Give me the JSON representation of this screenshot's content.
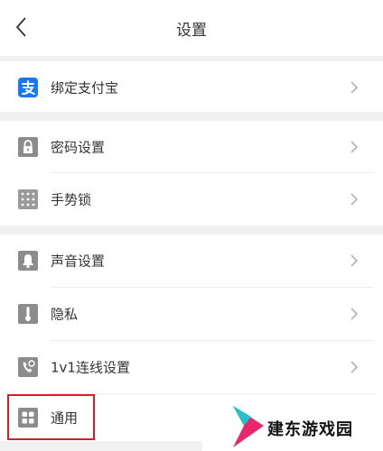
{
  "header": {
    "title": "设置",
    "back_icon": "chevron-left-icon"
  },
  "sections": [
    {
      "items": [
        {
          "label": "绑定支付宝",
          "icon": "alipay-icon",
          "icon_color": "#1677ff"
        }
      ]
    },
    {
      "items": [
        {
          "label": "密码设置",
          "icon": "lock-icon"
        },
        {
          "label": "手势锁",
          "icon": "gesture-grid-icon"
        }
      ]
    },
    {
      "items": [
        {
          "label": "声音设置",
          "icon": "bell-icon"
        },
        {
          "label": "隐私",
          "icon": "privacy-icon"
        },
        {
          "label": "1v1连线设置",
          "icon": "call-icon"
        },
        {
          "label": "通用",
          "icon": "grid-icon"
        }
      ]
    }
  ],
  "colors": {
    "highlight": "#d61f26",
    "icon_gray": "#8c8c8c",
    "alipay_blue": "#1677ff"
  },
  "watermark": {
    "text": "建东游戏园"
  }
}
